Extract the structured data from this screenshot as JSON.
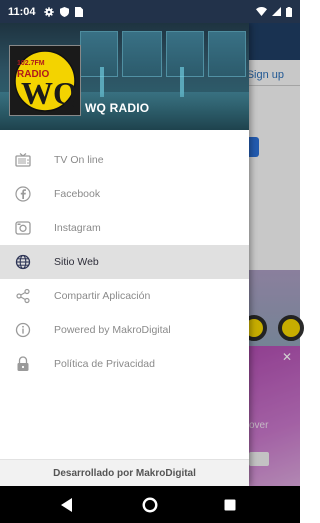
{
  "status_bar": {
    "time": "11:04",
    "left_icons": [
      "settings-icon",
      "shield-icon",
      "sim-card-icon"
    ],
    "right_icons": [
      "wifi-icon",
      "signal-icon",
      "battery-icon"
    ]
  },
  "background": {
    "signup_label": "Sign up",
    "promo_text": "over",
    "promo_close": "✕"
  },
  "drawer": {
    "title": "WQ RADIO",
    "logo": {
      "top_text": "102.7FM",
      "main_text": "RADIO",
      "letters": "WQ"
    },
    "items": [
      {
        "label": "TV On line",
        "icon": "tv-icon",
        "active": false
      },
      {
        "label": "Facebook",
        "icon": "facebook-icon",
        "active": false
      },
      {
        "label": "Instagram",
        "icon": "instagram-icon",
        "active": false
      },
      {
        "label": "Sitio Web",
        "icon": "globe-icon",
        "active": true
      },
      {
        "label": "Compartir Aplicación",
        "icon": "share-icon",
        "active": false
      },
      {
        "label": "Powered by MakroDigital",
        "icon": "info-icon",
        "active": false
      },
      {
        "label": "Política de Privacidad",
        "icon": "lock-icon",
        "active": false
      }
    ],
    "footer": "Desarrollado por MakroDigital"
  },
  "nav_bar": {
    "buttons": [
      "back-icon",
      "home-icon",
      "recents-icon"
    ]
  },
  "colors": {
    "status_bar": "#22324a",
    "active_item": "#e0e0e0",
    "logo_yellow": "#f3d300"
  }
}
